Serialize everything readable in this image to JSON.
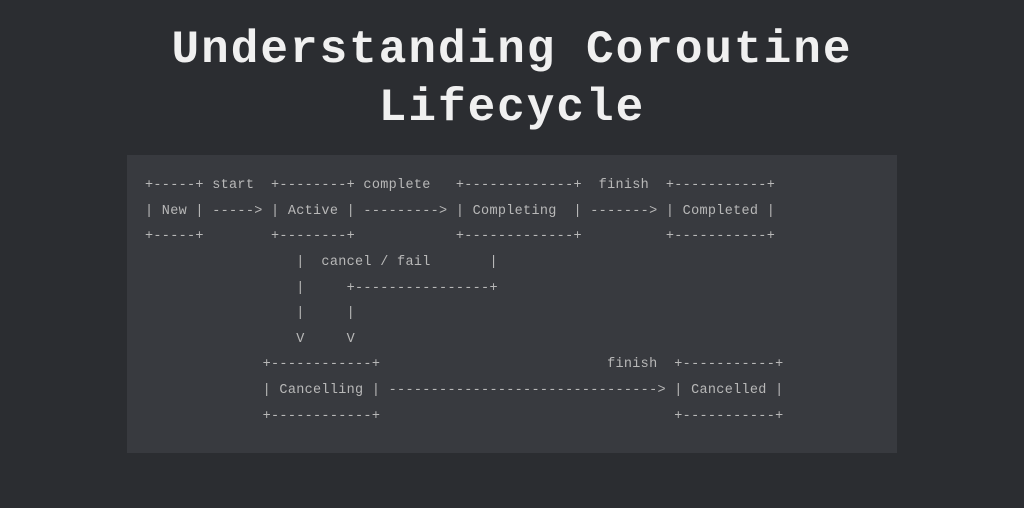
{
  "title_line1": "Understanding Coroutine",
  "title_line2": "Lifecycle",
  "diagram_lines": [
    "+-----+ start  +--------+ complete   +-------------+  finish  +-----------+",
    "| New | -----> | Active | ---------> | Completing  | -------> | Completed |",
    "+-----+        +--------+            +-------------+          +-----------+",
    "                  |  cancel / fail       |",
    "                  |     +----------------+",
    "                  |     |",
    "                  V     V",
    "              +------------+                           finish  +-----------+",
    "              | Cancelling | --------------------------------> | Cancelled |",
    "              +------------+                                   +-----------+"
  ],
  "chart_data": {
    "type": "diagram",
    "title": "Understanding Coroutine Lifecycle",
    "nodes": [
      "New",
      "Active",
      "Completing",
      "Completed",
      "Cancelling",
      "Cancelled"
    ],
    "edges": [
      {
        "from": "New",
        "to": "Active",
        "label": "start"
      },
      {
        "from": "Active",
        "to": "Completing",
        "label": "complete"
      },
      {
        "from": "Completing",
        "to": "Completed",
        "label": "finish"
      },
      {
        "from": "Active",
        "to": "Cancelling",
        "label": "cancel / fail"
      },
      {
        "from": "Completing",
        "to": "Cancelling",
        "label": "cancel / fail"
      },
      {
        "from": "Cancelling",
        "to": "Cancelled",
        "label": "finish"
      }
    ]
  }
}
